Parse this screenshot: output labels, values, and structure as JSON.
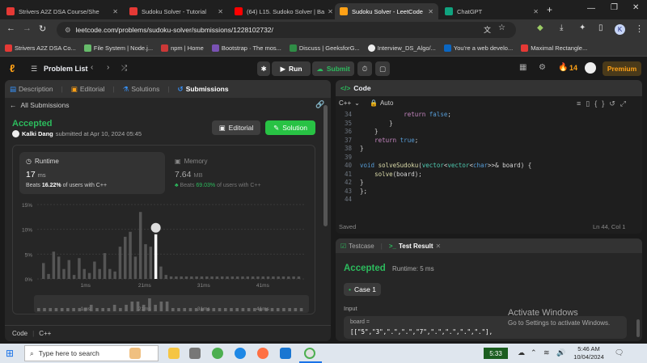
{
  "tabs": [
    {
      "label": "Strivers A2Z DSA Course/She",
      "fav_color": "#e53935"
    },
    {
      "label": "Sudoku Solver - Tutorial",
      "fav_color": "#e53935"
    },
    {
      "label": "(64) L15. Sudoko Solver | Ba",
      "fav_color": "#ff0000"
    },
    {
      "label": "Sudoku Solver - LeetCode",
      "fav_color": "#ffa116"
    },
    {
      "label": "ChatGPT",
      "fav_color": "#10a37f"
    }
  ],
  "url": "leetcode.com/problems/sudoku-solver/submissions/1228102732/",
  "profile_initial": "K",
  "bookmarks": [
    "Strivers A2Z DSA Co...",
    "File System | Node.j...",
    "npm | Home",
    "Bootstrap · The mos...",
    "Discuss | GeeksforG...",
    "Interview_DS_Algo/...",
    "You're a web develo...",
    "Maximal Rectangle..."
  ],
  "nav": {
    "problem_list": "Problem List",
    "run": "Run",
    "submit": "Submit",
    "streak": "14",
    "premium": "Premium"
  },
  "left_tabs": [
    "Description",
    "Editorial",
    "Solutions",
    "Submissions"
  ],
  "all_submissions": "All Submissions",
  "result": {
    "status": "Accepted",
    "author": "Kalki Dang",
    "submitted": "submitted at Apr 10, 2024 05:45",
    "editorial_btn": "Editorial",
    "solution_btn": "Solution"
  },
  "runtime": {
    "label": "Runtime",
    "value": "17",
    "unit": "ms",
    "beats_prefix": "Beats",
    "beats_value": "16.22%",
    "beats_suffix": "of users with C++"
  },
  "memory": {
    "label": "Memory",
    "value": "7.64",
    "unit": "MB",
    "beats_prefix": "Beats",
    "beats_value": "69.03%",
    "beats_suffix": "of users with C++"
  },
  "chart_data": {
    "type": "bar",
    "y_ticks": [
      "15%",
      "10%",
      "5%",
      "0%"
    ],
    "ylim": [
      0,
      15
    ],
    "x_ticks": [
      "1ms",
      "21ms",
      "31ms",
      "41ms"
    ],
    "values": [
      3.2,
      1,
      5.5,
      4.5,
      2,
      3.8,
      0.8,
      4.2,
      2,
      1.2,
      3.5,
      2,
      5.2,
      2,
      1.5,
      6.5,
      8.5,
      9.5,
      4.5,
      13.5,
      7,
      6.5,
      9,
      2.5,
      0.8,
      0.5,
      0.5,
      0.5,
      0.5,
      0.5,
      0.5,
      0.5,
      0.5,
      0.5,
      0.5,
      0.5,
      0.5,
      0.5,
      0.5,
      0.5,
      0.5,
      0.5,
      0.5,
      0.5,
      0.5,
      0.5,
      0.5,
      0.5,
      0.5,
      0.5,
      0.5
    ],
    "highlight_index": 22,
    "mini_values": [
      1,
      1,
      1,
      1,
      1,
      1,
      1,
      1,
      1,
      2,
      1,
      1,
      1,
      2,
      1,
      2,
      3,
      3,
      2,
      4,
      2,
      3,
      3,
      1,
      1,
      1,
      1,
      1,
      1,
      1,
      1,
      1,
      1,
      1,
      1,
      1,
      1,
      1,
      1,
      1,
      1,
      1,
      1,
      1,
      1,
      1
    ]
  },
  "code_footer": {
    "lang": "Code",
    "lang_value": "C++"
  },
  "editor": {
    "title": "Code",
    "lang": "C++",
    "mode": "Auto",
    "status_left": "Saved",
    "status_right": "Ln 44, Col 1",
    "lines": [
      {
        "n": "34",
        "text": "            return false;"
      },
      {
        "n": "35",
        "text": "        }"
      },
      {
        "n": "36",
        "text": "    }"
      },
      {
        "n": "37",
        "text": "    return true;"
      },
      {
        "n": "38",
        "text": "}"
      },
      {
        "n": "39",
        "text": ""
      },
      {
        "n": "40",
        "text": "void solveSudoku(vector<vector<char>>& board) {"
      },
      {
        "n": "41",
        "text": "    solve(board);"
      },
      {
        "n": "42",
        "text": "}"
      },
      {
        "n": "43",
        "text": "};"
      },
      {
        "n": "44",
        "text": ""
      }
    ]
  },
  "testpanel": {
    "testcase_tab": "Testcase",
    "result_tab": "Test Result",
    "status": "Accepted",
    "runtime": "Runtime: 5 ms",
    "case": "Case 1",
    "input_label": "Input",
    "board_label": "board =",
    "board_value": "[[\"5\",\"3\",\".\",\".\",\"7\",\".\",\".\",\".\",\".\"],"
  },
  "watermark": {
    "title": "Activate Windows",
    "sub": "Go to Settings to activate Windows."
  },
  "taskbar": {
    "search": "Type here to search",
    "battery": "5:33",
    "time": "5:46 AM",
    "date": "10/04/2024"
  },
  "colors": {
    "accepted": "#2cbb5d",
    "accent": "#ffa116",
    "link": "#3794ff",
    "solution_btn": "#28c244"
  }
}
